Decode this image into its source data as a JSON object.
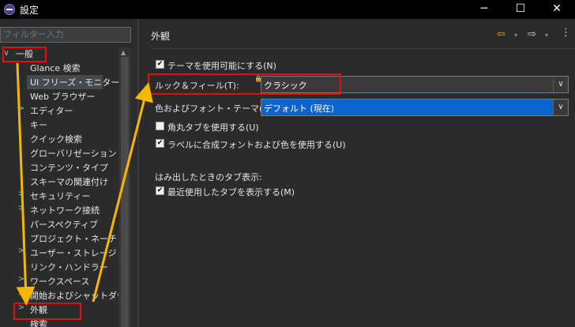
{
  "window": {
    "title": "設定",
    "min": "─",
    "max": "☐",
    "close": "✕"
  },
  "filter": {
    "placeholder": "フィルター入力"
  },
  "tree": [
    {
      "label": "一般",
      "twisty": "∨"
    },
    {
      "label": "Glance 検索"
    },
    {
      "label": "UI フリーズ・モニター"
    },
    {
      "label": "Web ブラウザー"
    },
    {
      "label": "エディター",
      "twisty": ">"
    },
    {
      "label": "キー"
    },
    {
      "label": "クイック検索"
    },
    {
      "label": "グローバリゼーション"
    },
    {
      "label": "コンテンツ・タイプ"
    },
    {
      "label": "スキーマの関連付け"
    },
    {
      "label": "セキュリティー",
      "twisty": ">"
    },
    {
      "label": "ネットワーク接続",
      "twisty": ">"
    },
    {
      "label": "パースペクティブ"
    },
    {
      "label": "プロジェクト・ネーチャー"
    },
    {
      "label": "ユーザー・ストレージ・サー",
      "twisty": ">"
    },
    {
      "label": "リンク・ハンドラー"
    },
    {
      "label": "ワークスペース",
      "twisty": ">"
    },
    {
      "label": "開始およびシャットダウン",
      "twisty": ">"
    },
    {
      "label": "外観",
      "twisty": ">"
    },
    {
      "label": "検索"
    }
  ],
  "page": {
    "title": "外観",
    "nav": {
      "back": "⇦",
      "forward": "⇨",
      "dropdown": "▾",
      "menu": "⋮"
    },
    "enable_theming": {
      "label": "テーマを使用可能にする(N)",
      "checked": "✔"
    },
    "look_and_feel": {
      "label": "ルック＆フィール(T):",
      "value": "クラシック"
    },
    "color_font_theme": {
      "label": "色およびフォント・テーマ(C):",
      "value": "デフォルト (現在)"
    },
    "rounded_tabs": {
      "label": "角丸タブを使用する(U)",
      "checked": ""
    },
    "mixed_fonts": {
      "label": "ラベルに合成フォントおよび色を使用する(U)",
      "checked": "✔"
    },
    "overflow_label": "はみ出したときのタブ表示:",
    "recent_tabs": {
      "label": "最近使用したタブを表示する(M)",
      "checked": "✔"
    },
    "combo_arrow": "∨",
    "lock": "🔒"
  },
  "colors": {
    "annotation_red": "#e01010",
    "annotation_arrow": "#f5b800",
    "selection_blue": "#0a64d2"
  }
}
